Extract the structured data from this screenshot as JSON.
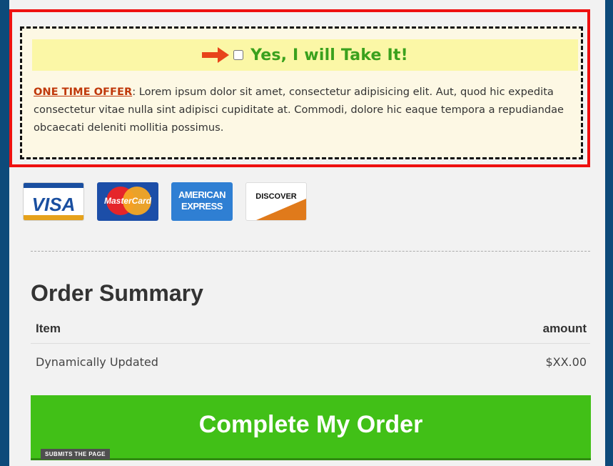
{
  "offer": {
    "take_label": "Yes, I will Take It!",
    "one_time_label": "ONE TIME OFFER",
    "description": ": Lorem ipsum dolor sit amet, consectetur adipisicing elit. Aut, quod hic expedita consectetur vitae nulla sint adipisci cupiditate at. Commodi, dolore hic eaque tempora a repudiandae obcaecati deleniti mollitia possimus."
  },
  "cards": {
    "visa": "VISA",
    "mastercard": "MasterCard",
    "amex_line1": "AMERICAN",
    "amex_line2": "EXPRESS",
    "discover": "DISCOVER"
  },
  "summary": {
    "title": "Order Summary",
    "col_item": "Item",
    "col_amount": "amount",
    "rows": [
      {
        "item": "Dynamically Updated",
        "amount": "$XX.00"
      }
    ]
  },
  "order_button": {
    "label": "Complete My Order",
    "tag": "SUBMITS THE PAGE"
  },
  "colors": {
    "accent_green": "#41c017",
    "offer_red": "#ee1111",
    "arrow": "#e8431a"
  }
}
